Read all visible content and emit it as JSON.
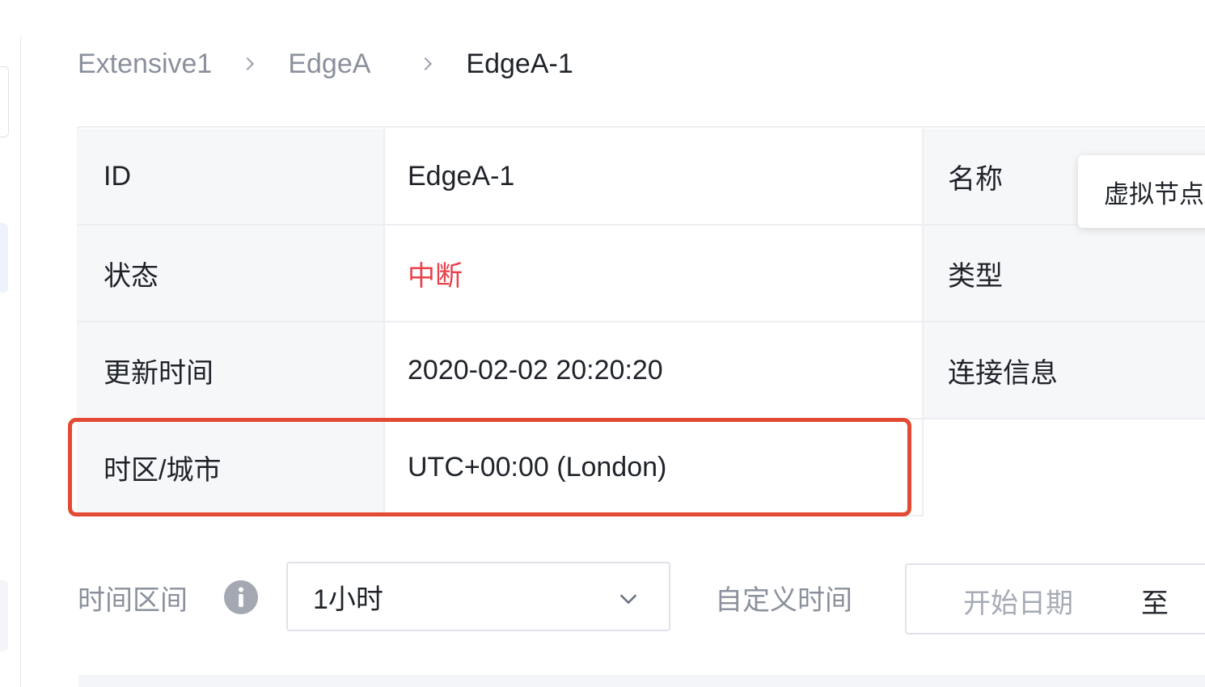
{
  "breadcrumb": {
    "items": [
      "Extensive1",
      "EdgeA",
      "EdgeA-1"
    ]
  },
  "info": {
    "rows": [
      {
        "label": "ID",
        "value": "EdgeA-1",
        "label2": "名称"
      },
      {
        "label": "状态",
        "value": "中断",
        "label2": "类型"
      },
      {
        "label": "更新时间",
        "value": "2020-02-02 20:20:20",
        "label2": "连接信息"
      },
      {
        "label": "时区/城市",
        "value": "UTC+00:00 (London)"
      }
    ],
    "status_color": "#e8414b"
  },
  "tooltip": {
    "text": "虚拟节点"
  },
  "filter": {
    "time_range_label": "时间区间",
    "time_range_value": "1小时",
    "custom_time_label": "自定义时间",
    "start_date_placeholder": "开始日期",
    "to_label": "至"
  },
  "colors": {
    "highlight": "#e34a33",
    "label_bg": "#f6f7f9"
  },
  "icons": {
    "breadcrumb_separator": "chevron-right-icon",
    "info": "info-icon",
    "dropdown": "chevron-down-icon"
  }
}
